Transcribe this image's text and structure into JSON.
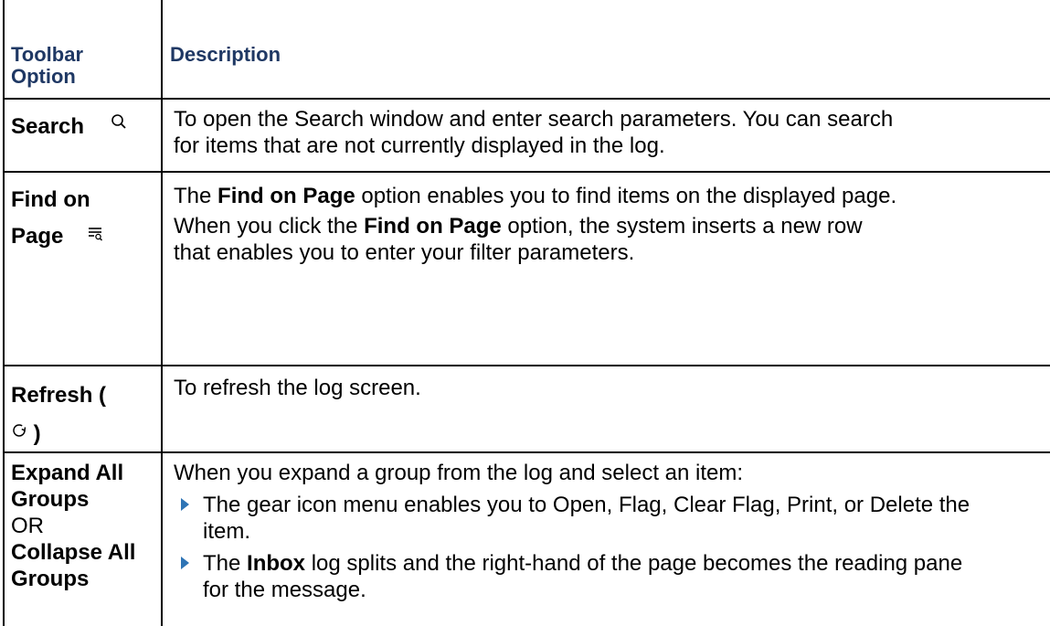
{
  "table": {
    "headers": {
      "option": "Toolbar Option",
      "description": "Description"
    },
    "rows": [
      {
        "option": "Search",
        "option_icon": "search-icon",
        "description": "To open the Search window and enter search parameters. You can search for items that are not currently displayed in the log."
      },
      {
        "option": "Find on Page",
        "option_icon": "find-on-page-icon",
        "description_1_pre": "The ",
        "description_1_bold": "Find on Page",
        "description_1_post": " option enables you to find items on the displayed page.",
        "description_2_pre": "When you click the ",
        "description_2_bold": "Find on Page",
        "description_2_post": " option, the system inserts a new row that enables you to enter your filter parameters."
      },
      {
        "option": "Refresh (",
        "option_icon": "refresh-icon",
        "option_close": ")",
        "description": "To refresh the log screen."
      },
      {
        "option_a": "Expand All Groups",
        "option_or": "OR",
        "option_b": "Collapse All Groups",
        "intro": "When you expand a group from the log and select an item:",
        "bullets": [
          {
            "text": "The gear icon menu enables you to Open, Flag, Clear Flag, Print, or Delete the item."
          },
          {
            "pre": "The ",
            "bold": "Inbox",
            "post": " log splits and the right-hand of the page becomes the reading pane for the message."
          }
        ]
      }
    ]
  },
  "colors": {
    "header_text": "#1F3864",
    "bullet": "#2E74B5",
    "rule": "#000000"
  }
}
